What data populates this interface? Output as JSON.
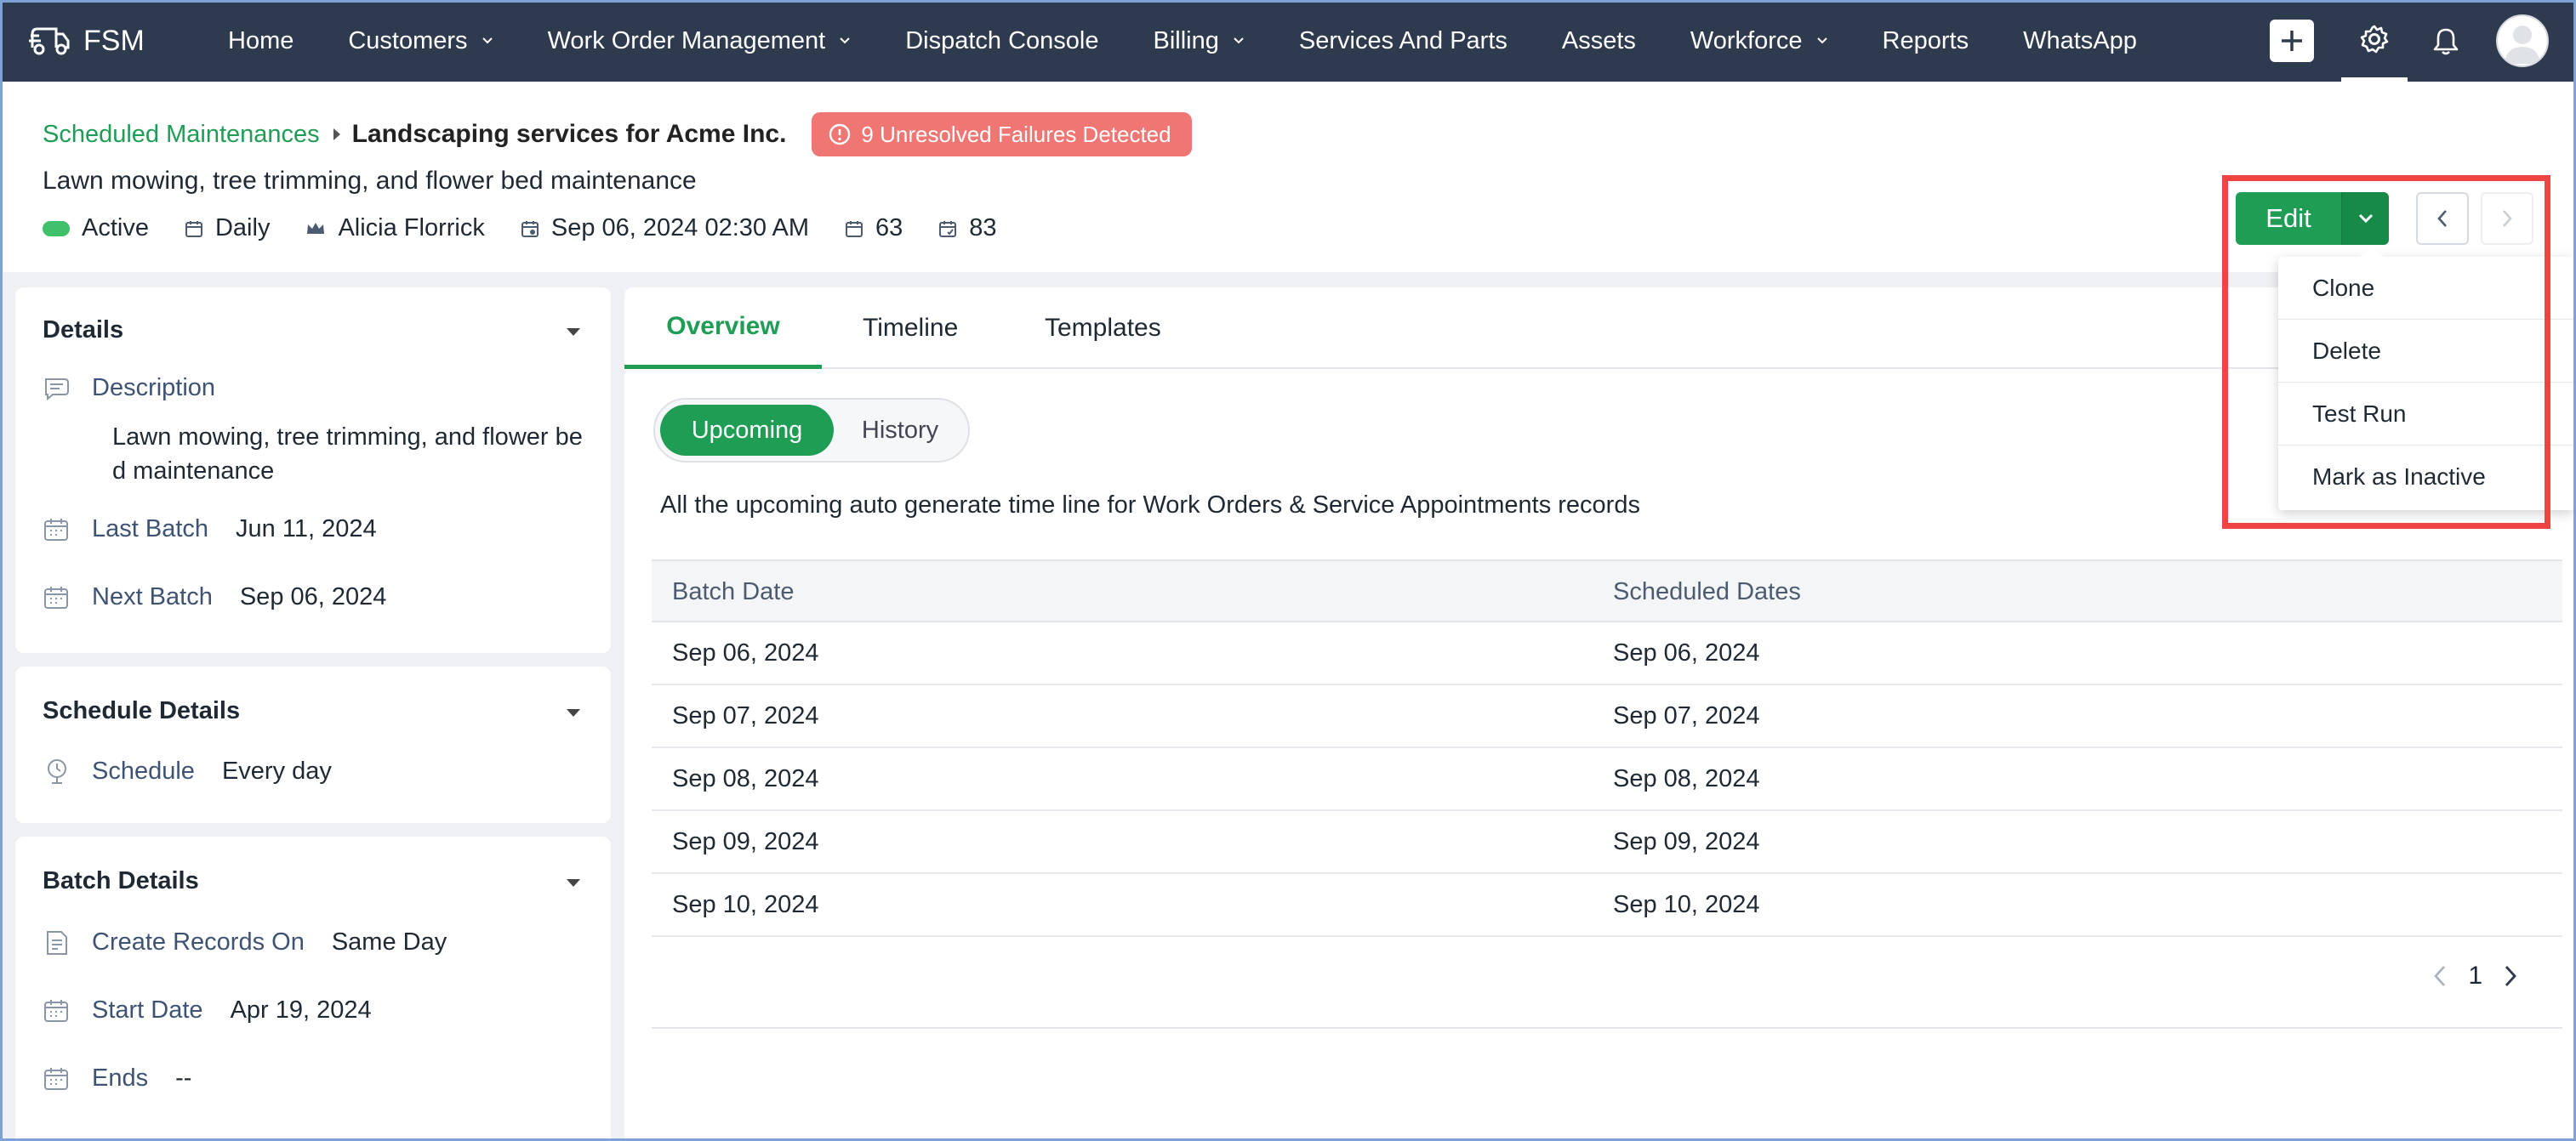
{
  "app": {
    "name": "FSM"
  },
  "nav": {
    "items": [
      {
        "label": "Home",
        "dropdown": false
      },
      {
        "label": "Customers",
        "dropdown": true
      },
      {
        "label": "Work Order Management",
        "dropdown": true
      },
      {
        "label": "Dispatch Console",
        "dropdown": false
      },
      {
        "label": "Billing",
        "dropdown": true
      },
      {
        "label": "Services And Parts",
        "dropdown": false
      },
      {
        "label": "Assets",
        "dropdown": false
      },
      {
        "label": "Workforce",
        "dropdown": true
      },
      {
        "label": "Reports",
        "dropdown": false
      },
      {
        "label": "WhatsApp",
        "dropdown": false
      }
    ]
  },
  "header": {
    "breadcrumb_parent": "Scheduled Maintenances",
    "title": "Landscaping services for Acme Inc.",
    "failure_badge": "9 Unresolved Failures Detected",
    "subtitle": "Lawn mowing, tree trimming, and flower bed maintenance",
    "meta": {
      "status": "Active",
      "frequency": "Daily",
      "owner": "Alicia Florrick",
      "next_run": "Sep 06, 2024 02:30 AM",
      "count_a": "63",
      "count_b": "83"
    },
    "edit_label": "Edit"
  },
  "dropdown_menu": {
    "items": [
      "Clone",
      "Delete",
      "Test Run",
      "Mark as Inactive"
    ]
  },
  "details_card": {
    "title": "Details",
    "description_label": "Description",
    "description_value": "Lawn mowing, tree trimming, and flower bed maintenance",
    "last_batch_label": "Last Batch",
    "last_batch_value": "Jun 11, 2024",
    "next_batch_label": "Next Batch",
    "next_batch_value": "Sep 06, 2024"
  },
  "schedule_card": {
    "title": "Schedule Details",
    "schedule_label": "Schedule",
    "schedule_value": "Every day"
  },
  "batch_card": {
    "title": "Batch Details",
    "create_label": "Create Records On",
    "create_value": "Same Day",
    "start_label": "Start Date",
    "start_value": "Apr 19, 2024",
    "ends_label": "Ends",
    "ends_value": "--"
  },
  "main": {
    "tabs": [
      "Overview",
      "Timeline",
      "Templates"
    ],
    "toggle_on": "Upcoming",
    "toggle_off": "History",
    "info_text": "All the upcoming auto generate time line for Work Orders & Service Appointments records",
    "columns": [
      "Batch Date",
      "Scheduled Dates"
    ],
    "rows": [
      [
        "Sep 06, 2024",
        "Sep 06, 2024"
      ],
      [
        "Sep 07, 2024",
        "Sep 07, 2024"
      ],
      [
        "Sep 08, 2024",
        "Sep 08, 2024"
      ],
      [
        "Sep 09, 2024",
        "Sep 09, 2024"
      ],
      [
        "Sep 10, 2024",
        "Sep 10, 2024"
      ]
    ],
    "page": "1"
  },
  "colors": {
    "nav_bg": "#2e3a4e",
    "accent_green": "#1f9d55",
    "failure_red": "#f07673",
    "highlight_red": "#ee4444"
  }
}
